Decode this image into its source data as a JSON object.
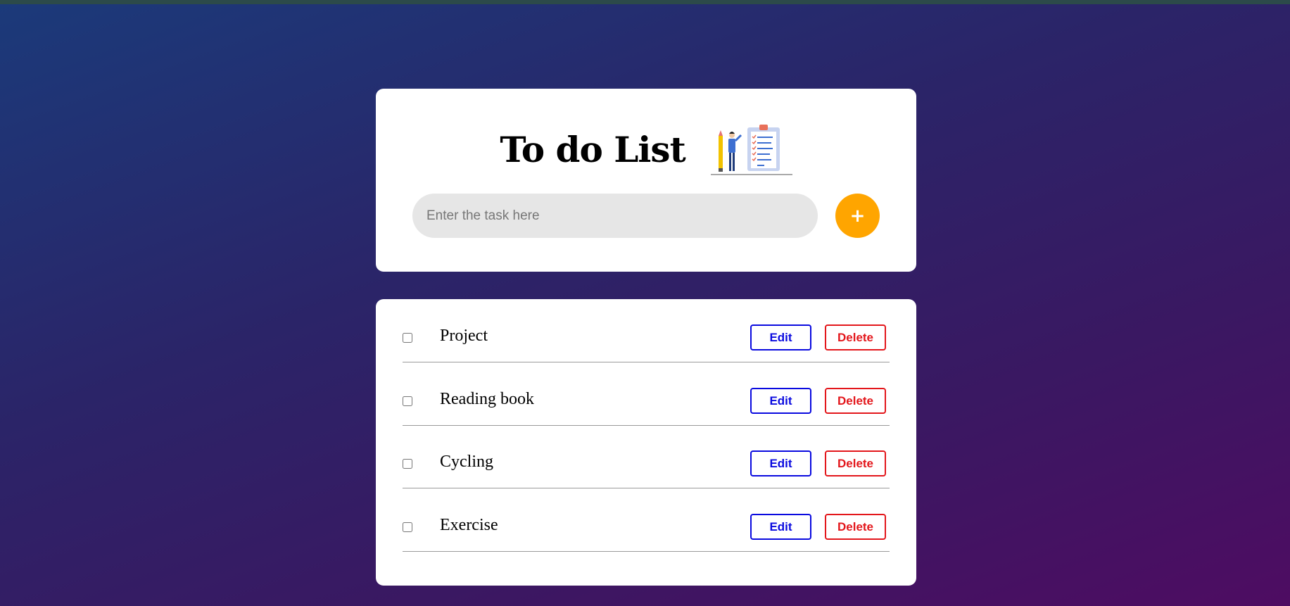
{
  "header": {
    "title": "To do List",
    "illustration_icon": "clipboard-checklist-illustration"
  },
  "input": {
    "placeholder": "Enter the task here",
    "value": ""
  },
  "add_button": {
    "label": "+"
  },
  "tasks": [
    {
      "label": "Project",
      "checked": false,
      "edit_label": "Edit",
      "delete_label": "Delete"
    },
    {
      "label": "Reading book",
      "checked": false,
      "edit_label": "Edit",
      "delete_label": "Delete"
    },
    {
      "label": "Cycling",
      "checked": false,
      "edit_label": "Edit",
      "delete_label": "Delete"
    },
    {
      "label": "Exercise",
      "checked": false,
      "edit_label": "Edit",
      "delete_label": "Delete"
    }
  ],
  "colors": {
    "accent": "#ffa500",
    "edit": "#0a0adf",
    "delete": "#e3161b",
    "input_bg": "#e6e6e6"
  }
}
